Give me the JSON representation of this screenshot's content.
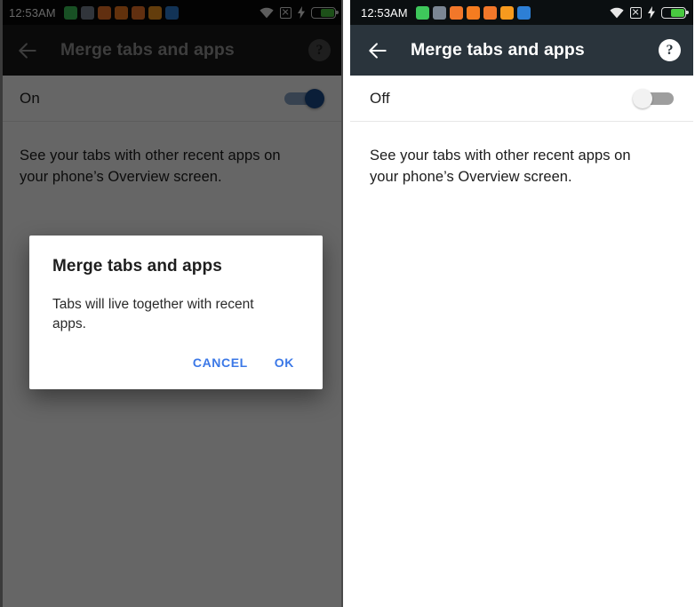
{
  "status_bar": {
    "clock": "12:53AM",
    "app_icons": [
      {
        "name": "green-app-icon",
        "color": "#3ec75b"
      },
      {
        "name": "gray-app-icon",
        "color": "#7b8694"
      },
      {
        "name": "orange-app-icon-1",
        "color": "#f2772a"
      },
      {
        "name": "firefox-icon",
        "color": "#f57c20"
      },
      {
        "name": "orange-app-icon-2",
        "color": "#f2772a"
      },
      {
        "name": "orange-shield-icon",
        "color": "#f79a1e"
      },
      {
        "name": "photos-app-icon",
        "color": "#2d7fd6"
      }
    ],
    "icons": {
      "wifi": "wifi-icon",
      "no_sim": "no-sim-icon",
      "charging": "charging-bolt-icon",
      "battery": "battery-icon"
    },
    "battery_fill_color": "#49c940"
  },
  "toolbar": {
    "back_label": "back-arrow",
    "title": "Merge tabs and apps",
    "help_label": "?"
  },
  "panels": [
    {
      "id": "left",
      "dimmed": true,
      "setting": {
        "state_label": "On",
        "switch_on": true,
        "thumb_color": "#1a4b8c",
        "track_color": "#8ba6c9"
      },
      "description": "See your tabs with other recent apps on your phone’s Overview screen.",
      "dialog": {
        "title": "Merge tabs and apps",
        "message": "Tabs will live together with recent apps.",
        "cancel_label": "CANCEL",
        "ok_label": "OK",
        "accent_color": "#3b78e7"
      }
    },
    {
      "id": "right",
      "dimmed": false,
      "setting": {
        "state_label": "Off",
        "switch_on": false,
        "thumb_color": "#f2f2f2",
        "track_color": "#9e9e9e"
      },
      "description": "See your tabs with other recent apps on your phone’s Overview screen."
    }
  ]
}
